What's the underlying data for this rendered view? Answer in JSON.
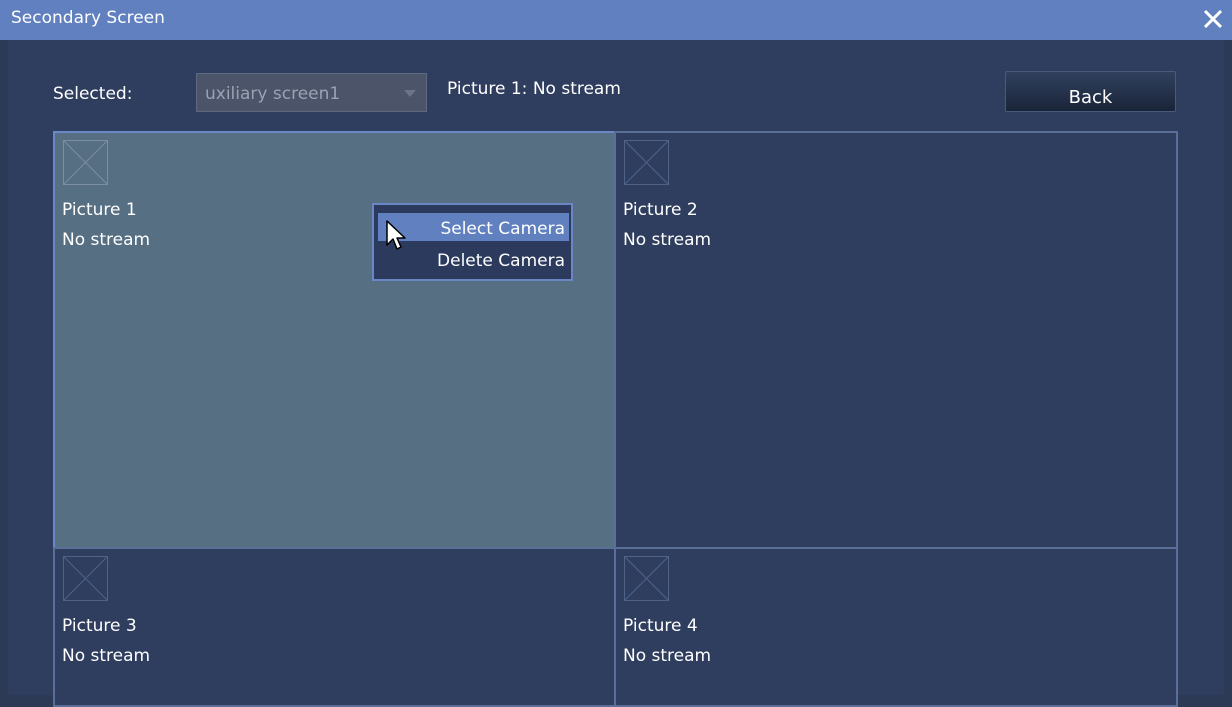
{
  "window": {
    "title": "Secondary Screen"
  },
  "icons": {
    "close": "close-icon",
    "no_image": "no-image-icon",
    "dropdown": "chevron-down-icon",
    "cursor": "mouse-cursor-icon"
  },
  "colors": {
    "titlebar": "#6180c0",
    "background": "#2f3e5f",
    "active_cell": "#576f82",
    "menu_highlight": "#6080c0"
  },
  "header": {
    "selected_label": "Selected:",
    "screen_select": {
      "value": "uxiliary screen1"
    },
    "status_text": "Picture 1: No stream",
    "back_label": "Back"
  },
  "pictures": [
    {
      "name": "Picture 1",
      "status": "No stream",
      "active": true
    },
    {
      "name": "Picture 2",
      "status": "No stream",
      "active": false
    },
    {
      "name": "Picture 3",
      "status": "No stream",
      "active": false
    },
    {
      "name": "Picture 4",
      "status": "No stream",
      "active": false
    }
  ],
  "context_menu": {
    "items": [
      {
        "label": "Select Camera",
        "highlighted": true
      },
      {
        "label": "Delete Camera",
        "highlighted": false
      }
    ]
  }
}
